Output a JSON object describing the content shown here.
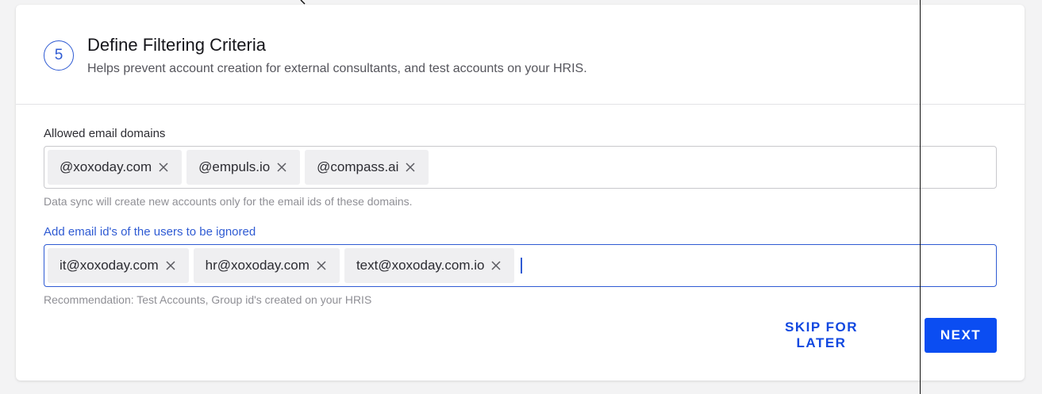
{
  "step": {
    "number": "5",
    "title": "Define Filtering Criteria",
    "subtitle": "Helps prevent account creation for external consultants, and test accounts on your HRIS."
  },
  "allowed_domains": {
    "label": "Allowed email domains",
    "chips": [
      "@xoxoday.com",
      "@empuls.io",
      "@compass.ai"
    ],
    "helper": "Data sync will create new accounts only for the email ids of these domains."
  },
  "ignored_users": {
    "label": "Add email id's of the users to be ignored",
    "chips": [
      "it@xoxoday.com",
      "hr@xoxoday.com",
      "text@xoxoday.com.io"
    ],
    "helper": "Recommendation: Test Accounts, Group id's created on your HRIS"
  },
  "actions": {
    "skip_label": "SKIP FOR LATER",
    "next_label": "NEXT"
  },
  "colors": {
    "accent": "#2f5bd3",
    "primary_button": "#0b4df2",
    "chip_bg": "#efeff1"
  },
  "icons": {
    "chip_remove": "close-icon"
  }
}
